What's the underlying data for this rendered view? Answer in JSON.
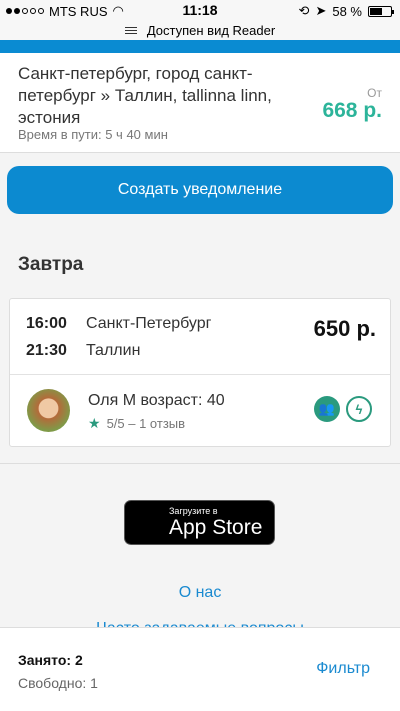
{
  "status": {
    "carrier": "MTS RUS",
    "time": "11:18",
    "battery": "58 %"
  },
  "reader": {
    "label": "Доступен вид Reader"
  },
  "route": {
    "title": "Санкт-петербург, город санкт-петербург » Таллин, tallinna linn, эстония",
    "duration": "Время в пути: 5 ч 40 мин",
    "price_from": "От",
    "price": "668 р."
  },
  "notify_button": "Создать уведомление",
  "day_heading": "Завтра",
  "trip": {
    "depart_time": "16:00",
    "depart_city": "Санкт-Петербург",
    "arrive_time": "21:30",
    "arrive_city": "Таллин",
    "price": "650 р.",
    "driver_name": "Оля М возраст: 40",
    "rating": "5/5 – 1 отзыв"
  },
  "appstore": {
    "small": "Загрузите в",
    "big": "App Store"
  },
  "links": {
    "about": "О нас",
    "faq": "Часто задаваемые вопросы"
  },
  "bottom": {
    "occupied": "Занято: 2",
    "free": "Свободно: 1",
    "filter": "Фильтр"
  },
  "colors": {
    "accent": "#0c8ad0",
    "price_green": "#2cb49a",
    "badge_green": "#2a9a7e"
  }
}
